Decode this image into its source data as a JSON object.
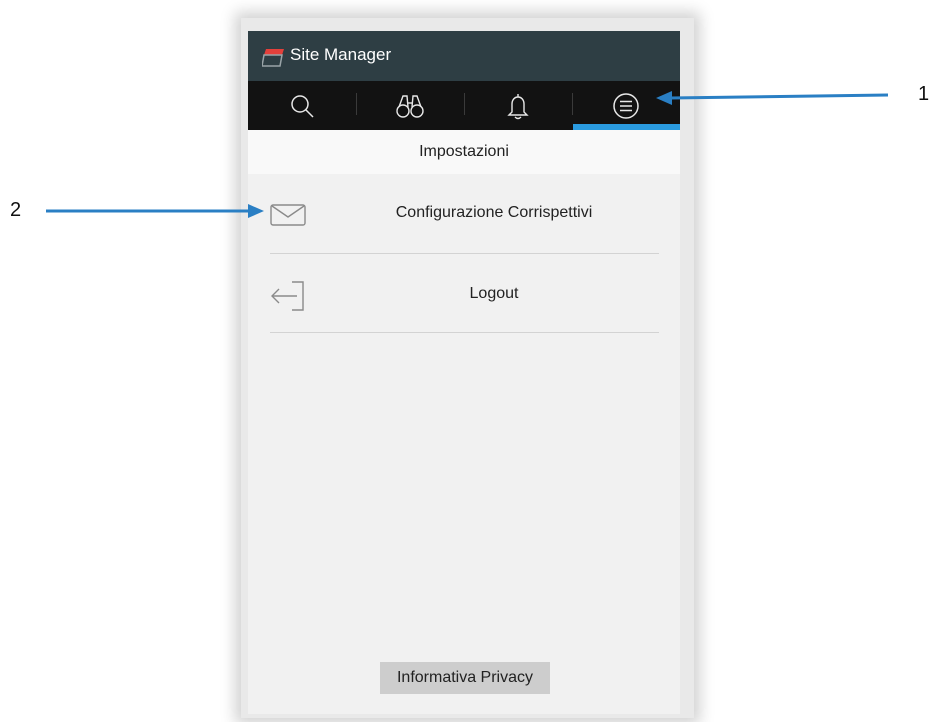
{
  "app": {
    "title": "Site Manager",
    "accent_color": "#2a9be0",
    "titlebar_color": "#2e3e44",
    "logo_color": "#e4403b"
  },
  "tabs": [
    {
      "icon": "search-icon"
    },
    {
      "icon": "binoculars-icon"
    },
    {
      "icon": "bell-icon"
    },
    {
      "icon": "menu-circle-icon",
      "selected": true
    }
  ],
  "header": {
    "title": "Impostazioni"
  },
  "menu": {
    "items": [
      {
        "label": "Configurazione Corrispettivi",
        "icon": "envelope-icon"
      },
      {
        "label": "Logout",
        "icon": "logout-icon"
      }
    ]
  },
  "footer": {
    "privacy_label": "Informativa Privacy"
  },
  "callouts": [
    {
      "number": "1"
    },
    {
      "number": "2"
    }
  ]
}
